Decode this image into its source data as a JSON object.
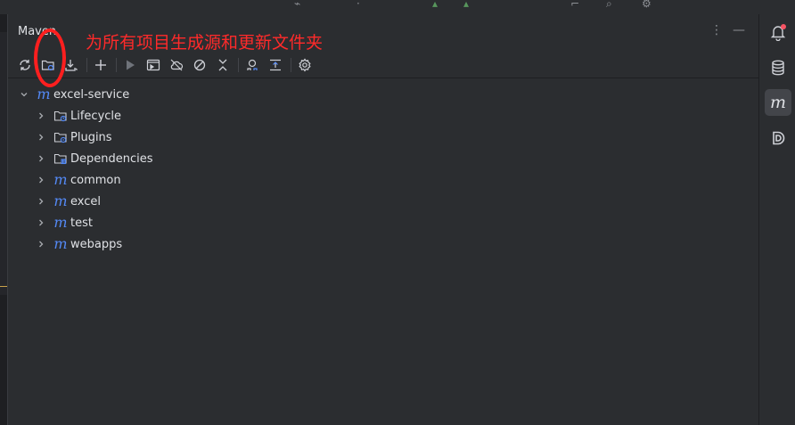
{
  "panel": {
    "title": "Maven",
    "more_label": "⋮",
    "minimize_label": "—"
  },
  "annotation": {
    "text": "为所有项目生成源和更新文件夹",
    "color": "#ff1f1f"
  },
  "toolbar": {
    "items": [
      {
        "icon": "reload-icon"
      },
      {
        "icon": "generate-sources-icon"
      },
      {
        "icon": "download-icon"
      },
      {
        "icon": "add-icon"
      },
      {
        "icon": "run-icon"
      },
      {
        "icon": "execute-goal-icon"
      },
      {
        "icon": "offline-mode-icon"
      },
      {
        "icon": "skip-tests-icon"
      },
      {
        "icon": "collapse-icon"
      },
      {
        "icon": "show-dependencies-icon"
      },
      {
        "icon": "expand-all-icon"
      },
      {
        "icon": "settings-icon"
      }
    ]
  },
  "tree": {
    "root": {
      "label": "excel-service",
      "icon": "maven-module-icon",
      "expanded": true
    },
    "children": [
      {
        "label": "Lifecycle",
        "icon": "lifecycle-folder-icon"
      },
      {
        "label": "Plugins",
        "icon": "plugins-folder-icon"
      },
      {
        "label": "Dependencies",
        "icon": "dependencies-folder-icon"
      },
      {
        "label": "common",
        "icon": "maven-module-icon"
      },
      {
        "label": "excel",
        "icon": "maven-module-icon"
      },
      {
        "label": "test",
        "icon": "maven-module-icon"
      },
      {
        "label": "webapps",
        "icon": "maven-module-icon"
      }
    ]
  },
  "rightbar": {
    "items": [
      {
        "icon": "notifications-icon",
        "has_badge": true
      },
      {
        "icon": "database-icon"
      },
      {
        "icon": "maven-icon",
        "active": true,
        "label": "m"
      },
      {
        "icon": "d-plugin-icon"
      }
    ]
  },
  "colors": {
    "maven_accent": "#548af7",
    "panel_bg": "#2b2d30",
    "annotation": "#ff1f1f"
  }
}
